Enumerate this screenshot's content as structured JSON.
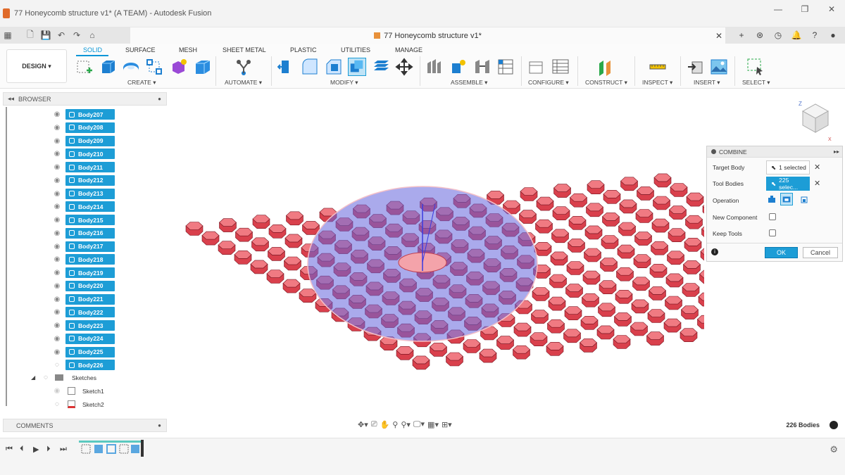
{
  "window": {
    "title": "77 Honeycomb structure v1* (A TEAM) - Autodesk Fusion"
  },
  "document_tab": {
    "title": "77 Honeycomb structure v1*"
  },
  "workspace": {
    "label": "DESIGN ▾"
  },
  "ribbon": {
    "tabs": [
      "SOLID",
      "SURFACE",
      "MESH",
      "SHEET METAL",
      "PLASTIC",
      "UTILITIES",
      "MANAGE"
    ],
    "groups": [
      "CREATE ▾",
      "AUTOMATE ▾",
      "MODIFY ▾",
      "ASSEMBLE ▾",
      "CONFIGURE ▾",
      "CONSTRUCT ▾",
      "INSPECT ▾",
      "INSERT ▾",
      "SELECT ▾"
    ]
  },
  "browser": {
    "title": "BROWSER",
    "bodies": [
      "Body207",
      "Body208",
      "Body209",
      "Body210",
      "Body211",
      "Body212",
      "Body213",
      "Body214",
      "Body215",
      "Body216",
      "Body217",
      "Body218",
      "Body219",
      "Body220",
      "Body221",
      "Body222",
      "Body223",
      "Body224",
      "Body225",
      "Body226"
    ],
    "folder": "Sketches",
    "sketches": [
      "Sketch1",
      "Sketch2"
    ]
  },
  "comments": {
    "title": "COMMENTS"
  },
  "combine": {
    "title": "COMBINE",
    "target_label": "Target Body",
    "target_value": "1 selected",
    "tool_label": "Tool Bodies",
    "tool_value": "225 selec...",
    "operation_label": "Operation",
    "new_component_label": "New Component",
    "keep_tools_label": "Keep Tools",
    "ok": "OK",
    "cancel": "Cancel"
  },
  "status": {
    "bodies": "226 Bodies"
  },
  "colors": {
    "accent": "#0696d7",
    "selection": "#1d9dd6",
    "cell_red": "#e8545e",
    "disk_blue": "#6a6ad0"
  }
}
